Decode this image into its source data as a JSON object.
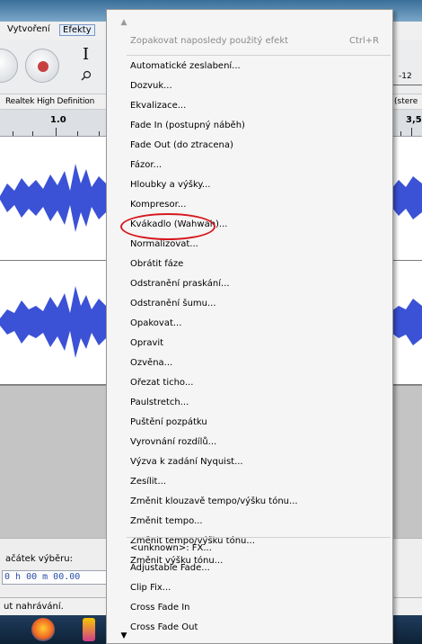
{
  "window": {
    "menubar": {
      "vytvoreni": "Vytvoření",
      "efekty": "Efekty"
    },
    "toolbar": {
      "db_value": "-12"
    },
    "device": {
      "name": "Realtek High Definition",
      "right_fragment": "(stere"
    },
    "ruler": {
      "label_1": "1.0",
      "label_2": "3,5"
    },
    "selection": {
      "label": "ačátek výběru:",
      "time": "0 h 00 m 00.00"
    },
    "status": {
      "text": "ut nahrávání."
    }
  },
  "effects_menu": {
    "items": [
      {
        "label": "Zopakovat naposledy použitý efekt",
        "shortcut": "Ctrl+R",
        "enabled": false
      },
      {
        "label": "Automatické zeslabení..."
      },
      {
        "label": "Dozvuk..."
      },
      {
        "label": "Ekvalizace..."
      },
      {
        "label": "Fade In (postupný náběh)"
      },
      {
        "label": "Fade Out (do ztracena)"
      },
      {
        "label": "Fázor..."
      },
      {
        "label": "Hloubky a výšky..."
      },
      {
        "label": "Kompresor..."
      },
      {
        "label": "Kvákadlo (Wahwah)..."
      },
      {
        "label": "Normalizovat..."
      },
      {
        "label": "Obrátit fáze"
      },
      {
        "label": "Odstranění praskání..."
      },
      {
        "label": "Odstranění šumu..."
      },
      {
        "label": "Opakovat..."
      },
      {
        "label": "Opravit"
      },
      {
        "label": "Ozvěna..."
      },
      {
        "label": "Ořezat ticho..."
      },
      {
        "label": "Paulstretch..."
      },
      {
        "label": "Puštění pozpátku"
      },
      {
        "label": "Vyrovnání rozdílů..."
      },
      {
        "label": "Výzva k zadání Nyquist..."
      },
      {
        "label": "Zesílit..."
      },
      {
        "label": "Změnit klouzavě tempo/výšku tónu..."
      },
      {
        "label": "Změnit tempo..."
      },
      {
        "label": "Změnit tempo/výšku tónu..."
      },
      {
        "label": "Změnit výšku tónu..."
      },
      {
        "label": "<unknown>: FX..."
      },
      {
        "label": "Adjustable Fade..."
      },
      {
        "label": "Clip Fix..."
      },
      {
        "label": "Cross Fade In"
      },
      {
        "label": "Cross Fade Out"
      }
    ],
    "highlighted_item": "Normalizovat...",
    "highlight_color": "#d6191f"
  },
  "colors": {
    "waveform": "#3b52d6",
    "record": "#c84141"
  },
  "icons": [
    "record-button-icon",
    "ibeam-tool-icon",
    "zoom-magnifier-icon",
    "firefox-taskbar-icon",
    "scroll-up-arrow-icon",
    "scroll-down-arrow-icon"
  ]
}
